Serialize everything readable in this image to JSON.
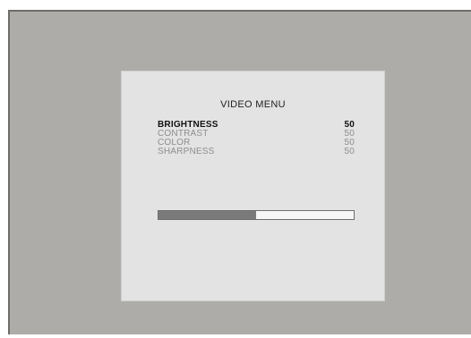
{
  "menu": {
    "title": "VIDEO MENU",
    "items": [
      {
        "label": "BRIGHTNESS",
        "value": "50",
        "selected": true
      },
      {
        "label": "CONTRAST",
        "value": "50",
        "selected": false
      },
      {
        "label": "COLOR",
        "value": "50",
        "selected": false
      },
      {
        "label": "SHARPNESS",
        "value": "50",
        "selected": false
      }
    ]
  },
  "level_bar": {
    "fraction": 0.5
  },
  "colors": {
    "screen_background": "#aeaca9",
    "panel_background": "#e3e3e3",
    "selected_text": "#111111",
    "unselected_text": "#8e8e8e",
    "bar_fill": "#7a7a7a"
  }
}
